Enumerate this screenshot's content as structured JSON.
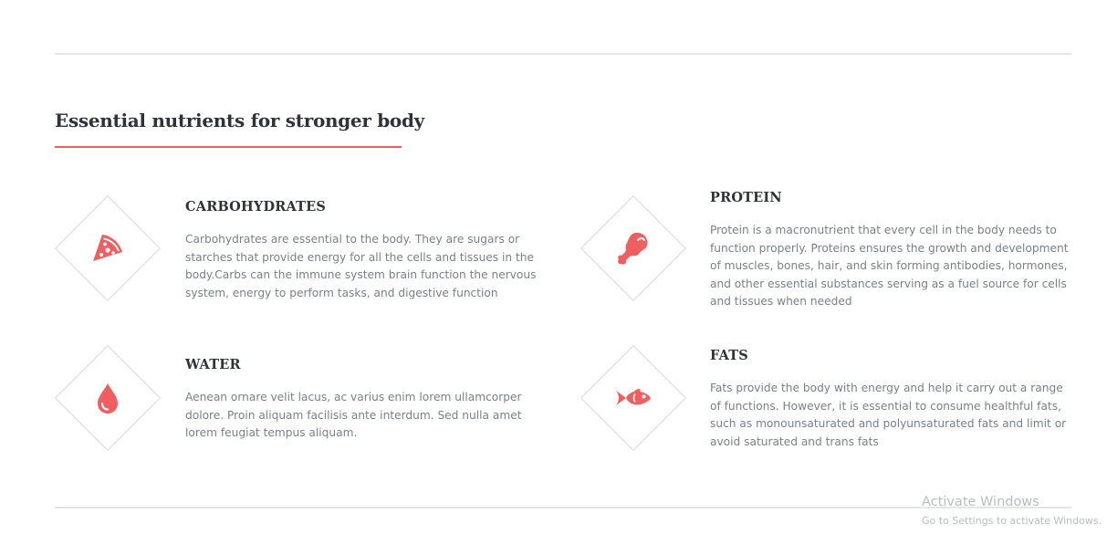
{
  "section": {
    "title": "Essential nutrients for stronger body",
    "accent_color": "#ef5f5f"
  },
  "items": [
    {
      "title": "CARBOHYDRATES",
      "text": "Carbohydrates are essential to the body. They are sugars or starches that provide energy for all the cells and tissues in the body.Carbs can the immune system brain function the nervous system, energy to perform tasks, and digestive function",
      "icon": "pizza-slice-icon"
    },
    {
      "title": "PROTEIN",
      "text": "Protein is a macronutrient that every cell in the body needs to function properly. Proteins ensures the growth and development of muscles, bones, hair, and skin forming antibodies, hormones, and other essential substances serving as a fuel source for cells and tissues when needed",
      "icon": "drumstick-icon"
    },
    {
      "title": "WATER",
      "text": "Aenean ornare velit lacus, ac varius enim lorem ullamcorper dolore. Proin aliquam facilisis ante interdum. Sed nulla amet lorem feugiat tempus aliquam.",
      "icon": "water-drop-icon"
    },
    {
      "title": "FATS",
      "text": "Fats provide the body with energy and help it carry out a range of functions. However, it is essential to consume healthful fats, such as monounsaturated and polyunsaturated fats and limit or avoid saturated and trans fats",
      "icon": "fish-icon"
    }
  ],
  "watermark": {
    "title": "Activate Windows",
    "subtitle": "Go to Settings to activate Windows."
  }
}
